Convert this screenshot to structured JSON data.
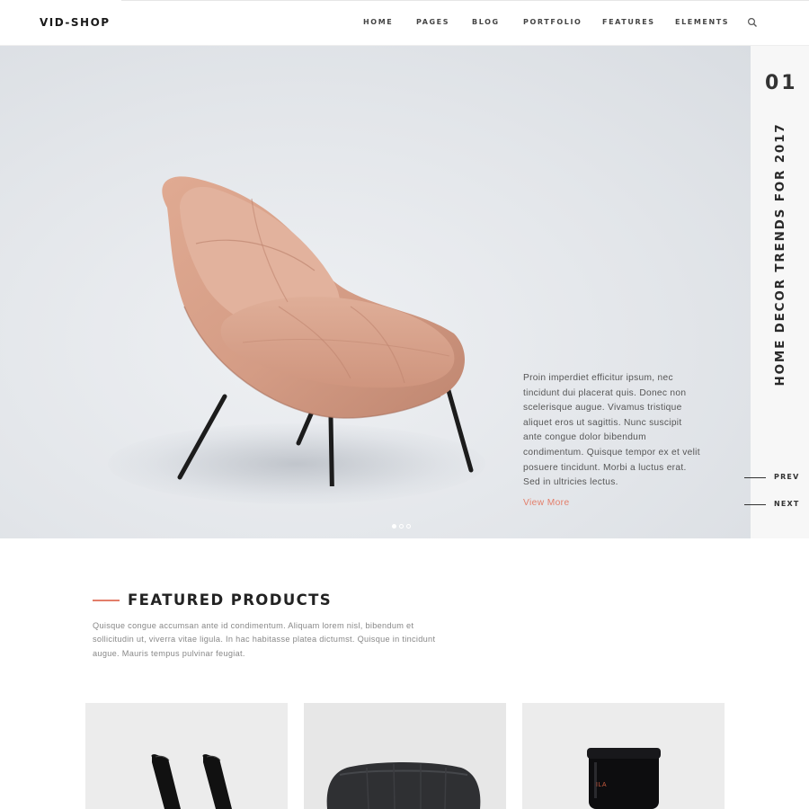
{
  "header": {
    "logo": "VID-SHOP",
    "nav": [
      {
        "label": "HOME"
      },
      {
        "label": "PAGES"
      },
      {
        "label": "BLOG"
      },
      {
        "label": "PORTFOLIO"
      },
      {
        "label": "FEATURES"
      },
      {
        "label": "ELEMENTS"
      }
    ],
    "search_icon": "search-icon"
  },
  "hero": {
    "slide_number": "01",
    "vertical_title": "HOME DECOR TRENDS FOR 2017",
    "text_lines": [
      "Proin imperdiet efficitur ipsum, nec",
      "tincidunt dui placerat quis. Donec non",
      "scelerisque augue. Vivamus tristique",
      "aliquet eros ut sagittis. Nunc suscipit",
      "ante congue dolor bibendum",
      "condimentum. Quisque tempor ex et velit",
      "posuere tincidunt. Morbi a luctus erat.",
      "Sed in ultricies lectus."
    ],
    "link": "View More",
    "prev": "PREV",
    "next": "NEXT",
    "dots": 3,
    "active_dot": 0,
    "colors": {
      "accent": "#e37e6a",
      "chair": "#d9a088"
    }
  },
  "featured": {
    "title": "FEATURED PRODUCTS",
    "desc_lines": [
      "Quisque congue accumsan ante id condimentum. Aliquam lorem nisl, bibendum et",
      "sollicitudin ut, viverra vitae ligula. In hac habitasse platea dictumst. Quisque in tincidunt",
      "augue. Mauris tempus pulvinar feugiat."
    ],
    "products": [
      {
        "name": "product-bookends"
      },
      {
        "name": "product-armchair"
      },
      {
        "name": "product-jar",
        "label": "ILA"
      }
    ]
  }
}
